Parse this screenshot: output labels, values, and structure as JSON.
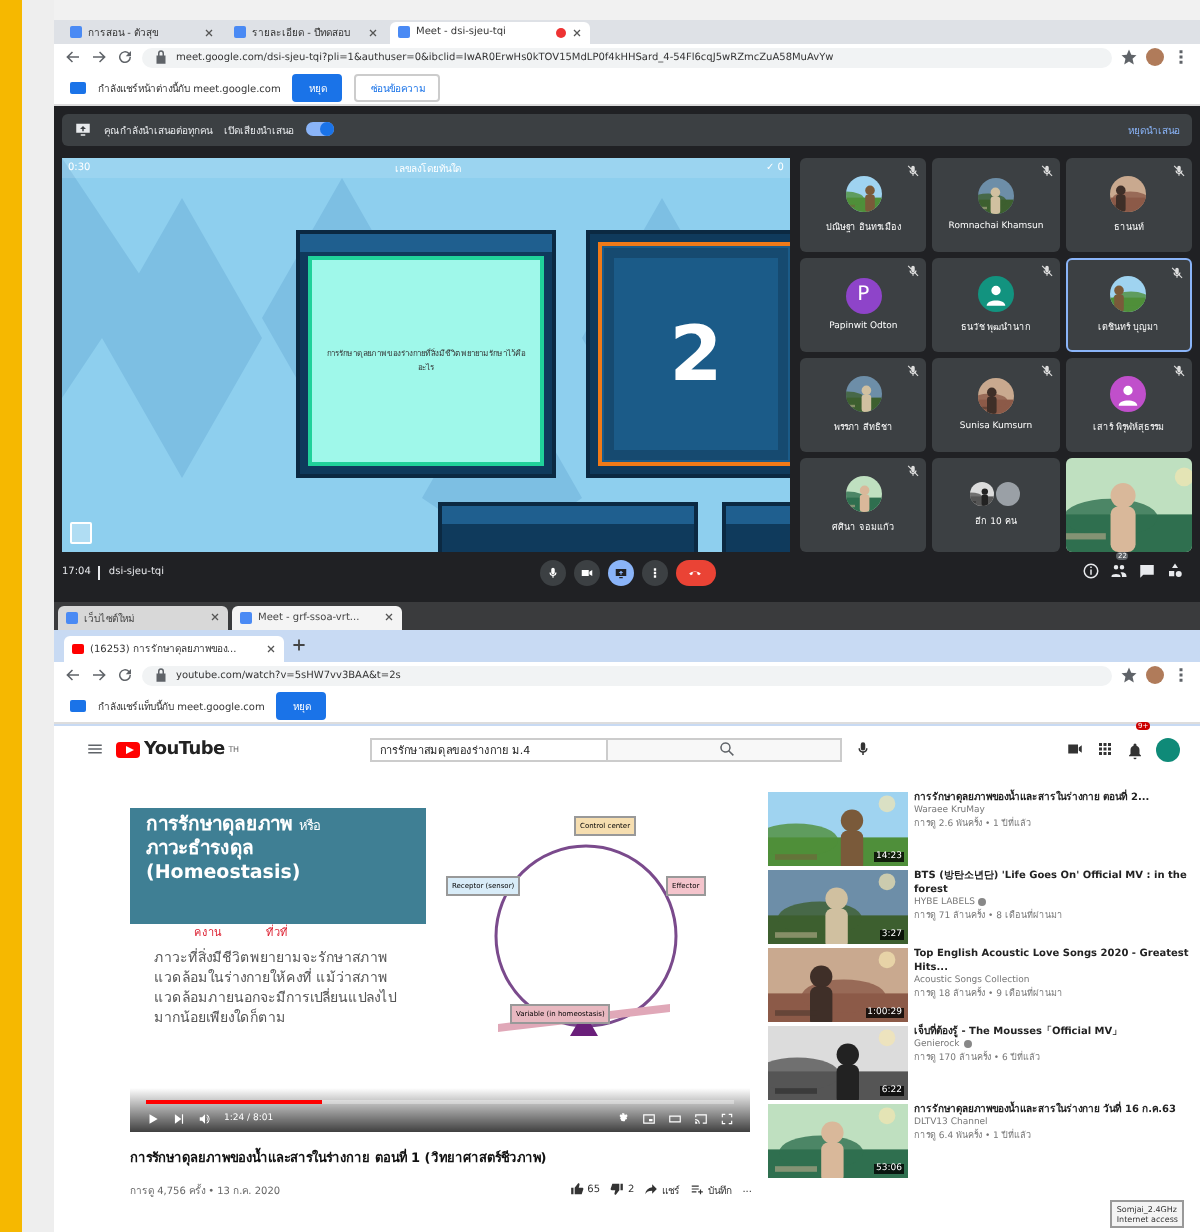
{
  "meet_browser": {
    "tabs": [
      {
        "title": "การสอน - ตัวสุข",
        "selected": false,
        "recording": false
      },
      {
        "title": "รายละเอียด - ปีทดสอบ",
        "selected": false,
        "recording": false
      },
      {
        "title": "Meet - dsi-sjeu-tqi",
        "selected": true,
        "recording": true
      }
    ],
    "url": "meet.google.com/dsi-sjeu-tqi?pli=1&authuser=0&ibclid=IwAR0ErwHs0kTOV15MdLP0f4kHHSard_4-54Fl6cqJ5wRZmcZuA58MuAvYw",
    "infobar": {
      "message": "กำลังแชร์หน้าต่างนี้กับ meet.google.com",
      "buttons": [
        {
          "label": "หยุด",
          "primary": true
        },
        {
          "label": "ซ่อนข้อความ",
          "primary": false
        }
      ]
    }
  },
  "meet": {
    "top_bar": {
      "label": "คุณกำลังนำเสนอต่อทุกคน",
      "toggle_label": "เปิดเสียงนำเสนอ",
      "toggle_on": true,
      "link": "หยุดนำเสนอ"
    },
    "presentation": {
      "timer": "0:30",
      "title": "เลขลงโดยทันใด",
      "score": "✓ 0",
      "card_text": "การรักษาดุลยภาพของร่างกายที่สิ่งมีชีวิตพยายามรักษาไว้คืออะไร",
      "card_number": "2"
    },
    "participants": [
      {
        "name": "ปณิษฐา อินทรเมือง",
        "muted": true,
        "selected": false
      },
      {
        "name": "Romnachai Khamsun",
        "muted": true,
        "selected": false
      },
      {
        "name": "ธานนท์",
        "muted": true,
        "selected": false
      },
      {
        "name": "Papinwit Odton",
        "kind": "letter",
        "letter": "P",
        "color": "#8e44c9",
        "muted": true,
        "selected": false
      },
      {
        "name": "ธนวัช พุฒนำนาก",
        "kind": "silhouette",
        "color": "#12937f",
        "muted": true,
        "selected": false
      },
      {
        "name": "เตชินทร์ บุญมา",
        "muted": true,
        "selected": true
      },
      {
        "name": "พรรภา สีทธิชา",
        "muted": true,
        "selected": false
      },
      {
        "name": "Sunisa Kumsurn",
        "muted": true,
        "selected": false
      },
      {
        "name": "เสาร์ พิรุฬห์สุธรรม",
        "kind": "silhouette",
        "color": "#c04fcb",
        "muted": true,
        "selected": false
      },
      {
        "name": "ศศินา จอมแก้ว",
        "muted": true,
        "selected": false
      },
      {
        "name": "อีก 10 คน",
        "kind": "group",
        "muted": false,
        "selected": false
      },
      {
        "kind": "video",
        "muted": false,
        "selected": false
      }
    ],
    "bottom_bar": {
      "time": "17:04",
      "code": "dsi-sjeu-tqi",
      "presenting": true,
      "people_count": "22"
    }
  },
  "youtube_browser": {
    "back_tabs": [
      {
        "title": "เว็บไซต์ใหม่"
      },
      {
        "title": "Meet - grf-ssoa-vrt..."
      }
    ],
    "tabs": [
      {
        "title": "(16253) การรักษาดุลยภาพของ...",
        "selected": true
      }
    ],
    "url": "youtube.com/watch?v=5sHW7vv3BAA&t=2s",
    "infobar": {
      "message": "กำลังแชร์แท็บนี้กับ meet.google.com",
      "button": "หยุด"
    }
  },
  "youtube": {
    "logo": "YouTube",
    "logo_region": "TH",
    "search": "การรักษาสมดุลของร่างกาย ม.4",
    "notifications": "9+",
    "video": {
      "slide": {
        "title": "การรักษาดุลยภาพ",
        "title_suffix": "หรือ",
        "subtitle": "ภาวะธำรงดุล",
        "english": "(Homeostasis)",
        "notes": [
          "คงาน",
          "ที่วที่"
        ],
        "body": "ภาวะที่สิ่งมีชีวิตพยายามจะรักษาสภาพแวดล้อมในร่างกายให้คงที่ แม้ว่าสภาพแวดล้อมภายนอกจะมีการเปลี่ยนแปลงไปมากน้อยเพียงใดก็ตาม",
        "nodes": [
          {
            "kind": "center",
            "label": "Control center"
          },
          {
            "kind": "receptor",
            "label": "Receptor (sensor)"
          },
          {
            "kind": "effector",
            "label": "Effector"
          },
          {
            "kind": "variable",
            "label": "Variable (in homeostasis)"
          }
        ]
      },
      "level": 0.3,
      "time": "1:24 / 8:01"
    },
    "title": "การรักษาดุลยภาพของน้ำและสารในร่างกาย ตอนที่ 1 (วิทยาศาสตร์ชีวภาพ)",
    "meta": "การดู 4,756 ครั้ง • 13 ก.ค. 2020",
    "likes": "65",
    "dislikes": "2",
    "share": "แชร์",
    "save": "บันทึก",
    "more": "...",
    "related": [
      {
        "title": "การรักษาดุลยภาพของน้ำและสารในร่างกาย ตอนที่ 2...",
        "channel": "Waraee KruMay",
        "meta": "การดู 2.6 พันครั้ง • 1 ปีที่แล้ว",
        "duration": "14:23",
        "verified": false
      },
      {
        "title": "BTS (방탄소년단) 'Life Goes On' Official MV : in the forest",
        "channel": "HYBE LABELS",
        "meta": "การดู 71 ล้านครั้ง • 8 เดือนที่ผ่านมา",
        "duration": "3:27",
        "verified": true
      },
      {
        "title": "Top English Acoustic Love Songs 2020 - Greatest Hits...",
        "channel": "Acoustic Songs Collection",
        "meta": "การดู 18 ล้านครั้ง • 9 เดือนที่ผ่านมา",
        "duration": "1:00:29",
        "verified": false
      },
      {
        "title": "เจ็บที่ต้องรู้ - The Mousses「Official MV」",
        "channel": "Genierock",
        "meta": "การดู 170 ล้านครั้ง • 6 ปีที่แล้ว",
        "duration": "6:22",
        "verified": true
      },
      {
        "title": "การรักษาดุลยภาพของน้ำและสารในร่างกาย วันที่ 16 ก.ค.63",
        "channel": "DLTV13 Channel",
        "meta": "การดู 6.4 พันครั้ง • 1 ปีที่แล้ว",
        "duration": "53:06",
        "verified": false
      }
    ],
    "tooltip": {
      "network": "Somjai_2.4GHz",
      "status": "Internet access"
    }
  }
}
